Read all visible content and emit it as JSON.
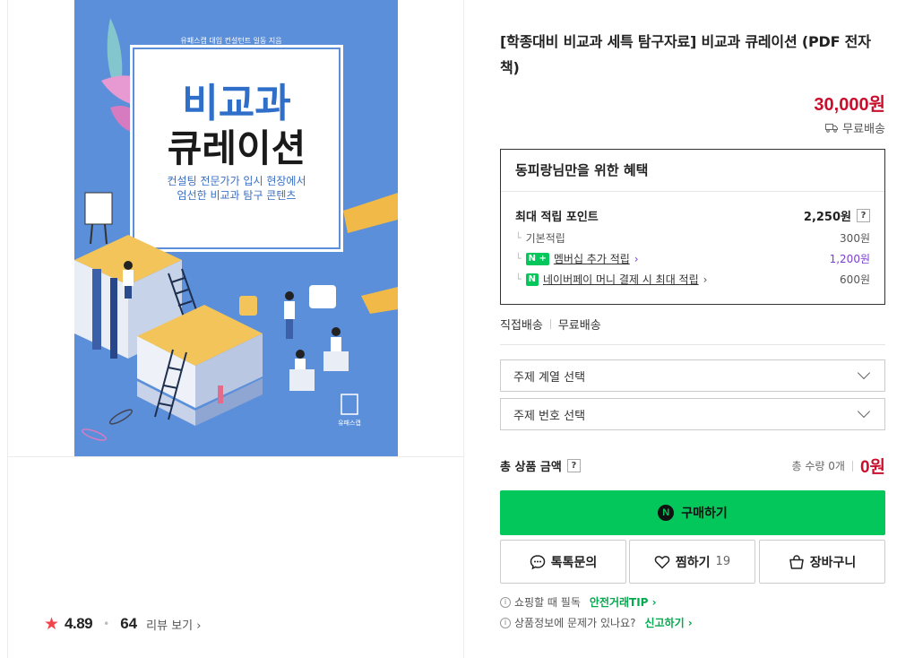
{
  "product": {
    "title": "[학종대비 비교과 세특 탐구자료] 비교과 큐레이션 (PDF 전자책)",
    "price": "30,000원",
    "shipping": "무료배송"
  },
  "cover": {
    "author": "유패스캡 대입 컨설턴트 일동 지음",
    "title_line1": "비교과",
    "title_line2": "큐레이션",
    "subtitle_line1": "컨설팅 전문가가 입시 현장에서",
    "subtitle_line2": "엄선한 비교과 탐구 콘텐츠",
    "publisher": "유패스캡"
  },
  "review": {
    "score": "4.89",
    "count": "64",
    "link": "리뷰 보기"
  },
  "benefit": {
    "heading": "동피랑님만을 위한 혜택",
    "max_points_label": "최대 적립 포인트",
    "max_points_value": "2,250원",
    "rows": [
      {
        "label": "기본적립",
        "value": "300원"
      },
      {
        "label": "멤버십 추가 적립",
        "value": "1,200원",
        "badge": "N +"
      },
      {
        "label": "네이버페이 머니 결제 시 최대 적립",
        "value": "600원",
        "badge": "N"
      }
    ]
  },
  "delivery": {
    "type": "직접배송",
    "fee": "무료배송"
  },
  "options": [
    {
      "placeholder": "주제 계열 선택"
    },
    {
      "placeholder": "주제 번호 선택"
    }
  ],
  "total": {
    "label": "총 상품 금액",
    "quantity": "총 수량 0개",
    "amount": "0원"
  },
  "actions": {
    "buy": "구매하기",
    "talk": "톡톡문의",
    "wish": "찜하기",
    "wish_count": "19",
    "cart": "장바구니"
  },
  "notices": [
    {
      "text": "쇼핑할 때 필독",
      "link": "안전거래TIP"
    },
    {
      "text": "상품정보에 문제가 있나요?",
      "link": "신고하기"
    }
  ],
  "colors": {
    "price_red": "#c8102e",
    "naver_green": "#03c75a",
    "cover_blue": "#5b8fd9"
  }
}
